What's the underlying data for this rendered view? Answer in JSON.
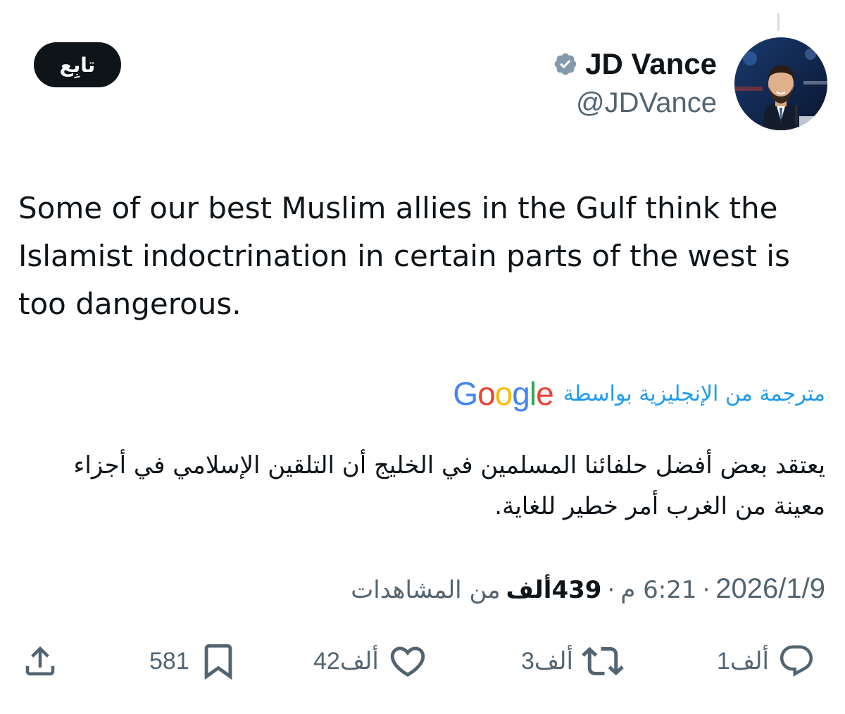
{
  "header": {
    "display_name": "JD Vance",
    "handle": "@JDVance",
    "follow_label": "تابِع"
  },
  "tweet": {
    "text": "Some of our best Muslim allies in the Gulf think the Islamist indoctrination in certain parts of the west is too dangerous."
  },
  "translation": {
    "label": "مترجمة من الإنجليزية بواسطة",
    "provider": "Google",
    "text": "يعتقد بعض أفضل حلفائنا المسلمين في الخليج أن التلقين الإسلامي في أجزاء معينة من الغرب أمر خطير للغاية."
  },
  "meta": {
    "date": "2026/1/9",
    "separator": "·",
    "time": "6:21 م",
    "views_count": "439ألف",
    "views_label": "من المشاهدات"
  },
  "actions": {
    "replies": "1ألف",
    "reposts": "3ألف",
    "likes": "42ألف",
    "bookmarks": "581"
  },
  "colors": {
    "accent": "#1d9bf0",
    "text_primary": "#0f1419",
    "text_secondary": "#536471",
    "verified_badge": "#829aab",
    "google_blue": "#4285f4",
    "google_red": "#ea4335",
    "google_yellow": "#fbbc05",
    "google_green": "#34a853"
  },
  "icons": {
    "reply": "speech-bubble",
    "repost": "circular-arrows",
    "like": "heart-outline",
    "bookmark": "bookmark-outline",
    "share": "share-upload",
    "verified": "verified-badge"
  }
}
